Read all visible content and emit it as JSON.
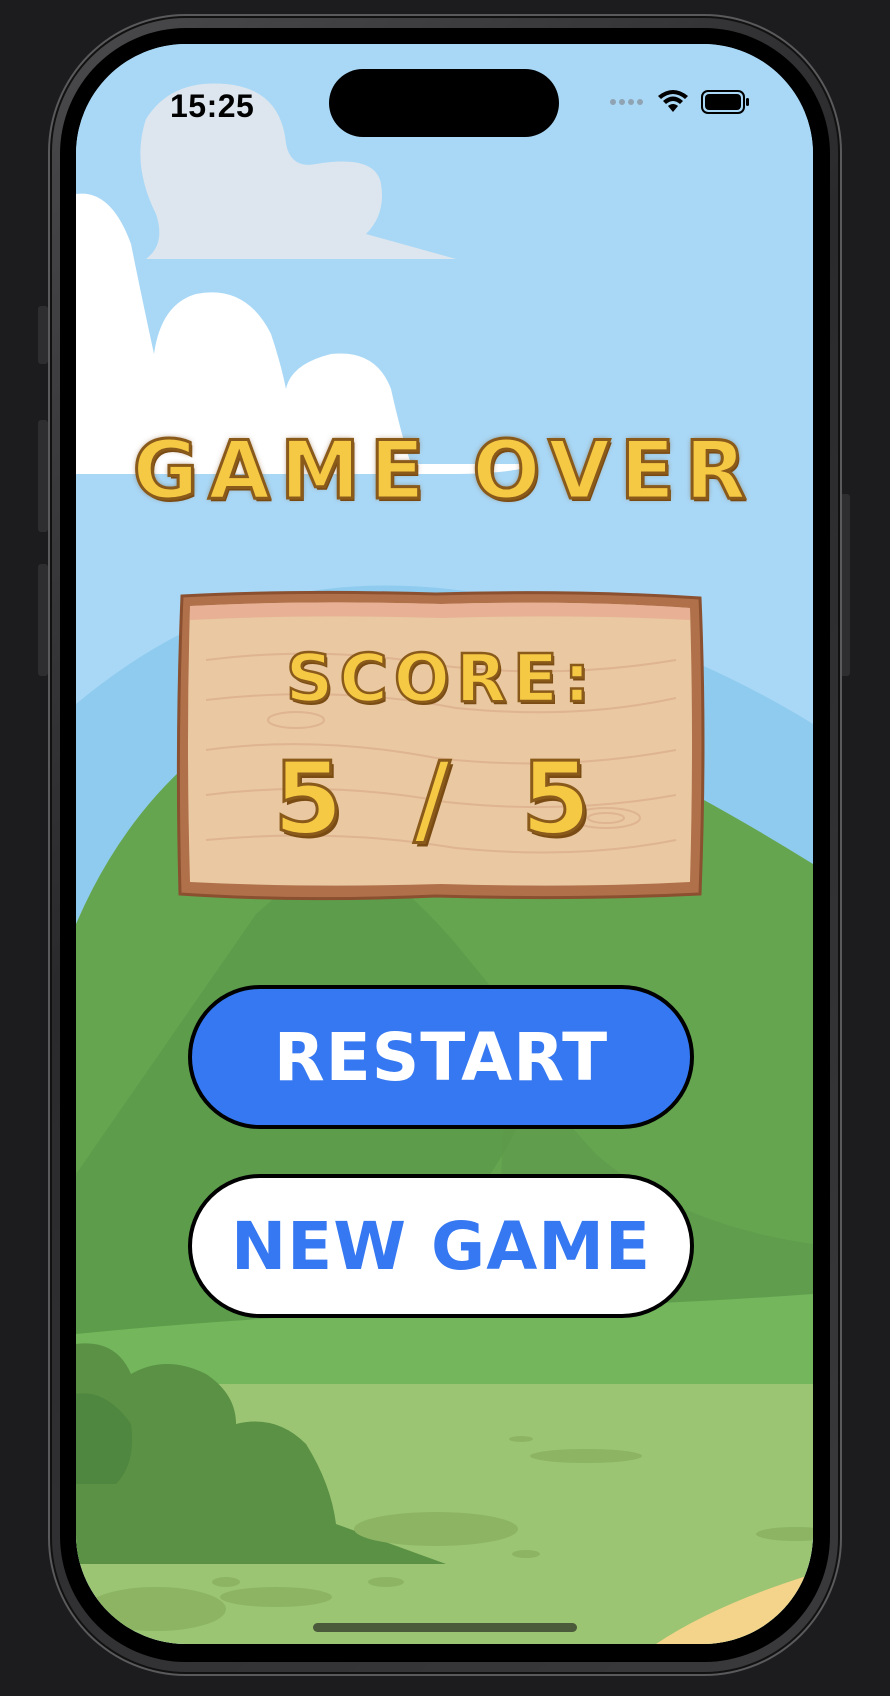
{
  "status_bar": {
    "time": "15:25",
    "icons": [
      "signal-dots-icon",
      "wifi-icon",
      "battery-icon"
    ]
  },
  "game": {
    "title": "GAME OVER",
    "score_label": "SCORE:",
    "score_value": "5 / 5",
    "score": 5,
    "total": 5
  },
  "buttons": {
    "restart_label": "RESTART",
    "new_game_label": "NEW GAME"
  },
  "colors": {
    "title_yellow": "#f6c945",
    "button_blue": "#3578f2",
    "sky": "#aad8f5",
    "wood": "#e9c8a2"
  }
}
